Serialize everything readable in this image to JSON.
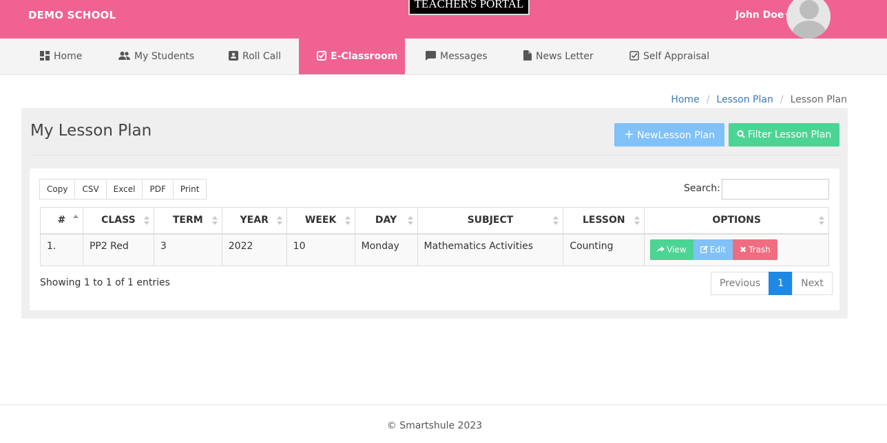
{
  "header": {
    "school_name": "DEMO SCHOOL",
    "portal_title": "TEACHER'S PORTAL",
    "user_name": "John Doe"
  },
  "nav": {
    "items": [
      {
        "label": "Home",
        "icon": "dashboard-icon"
      },
      {
        "label": "My Students",
        "icon": "people-icon"
      },
      {
        "label": "Roll Call",
        "icon": "contact-card-icon"
      },
      {
        "label": "E-Classroom",
        "icon": "checkbox-icon"
      },
      {
        "label": "Messages",
        "icon": "chat-icon"
      },
      {
        "label": "News Letter",
        "icon": "document-icon"
      },
      {
        "label": "Self Appraisal",
        "icon": "checkbox-icon"
      }
    ],
    "active": "E-Classroom"
  },
  "breadcrumb": [
    "Home",
    "Lesson Plan",
    "Lesson Plan"
  ],
  "panel": {
    "title": "My Lesson Plan",
    "new_button": "NewLesson Plan",
    "filter_button": "Filter Lesson Plan"
  },
  "export_buttons": [
    "Copy",
    "CSV",
    "Excel",
    "PDF",
    "Print"
  ],
  "search": {
    "label": "Search:",
    "value": ""
  },
  "table": {
    "columns": [
      "#",
      "CLASS",
      "TERM",
      "YEAR",
      "WEEK",
      "DAY",
      "SUBJECT",
      "LESSON",
      "OPTIONS"
    ],
    "rows": [
      {
        "num": "1.",
        "class": "PP2 Red",
        "term": "3",
        "year": "2022",
        "week": "10",
        "day": "Monday",
        "subject": "Mathematics Activities",
        "lesson": "Counting"
      }
    ],
    "actions": {
      "view": "View",
      "edit": "Edit",
      "trash": "Trash"
    }
  },
  "info": "Showing 1 to 1 of 1 entries",
  "pagination": {
    "previous": "Previous",
    "current": "1",
    "next": "Next"
  },
  "footer": "© Smartshule 2023",
  "colors": {
    "brand": "#f06292",
    "view": "#4cd495",
    "edit": "#80c1f8",
    "trash": "#f06c80",
    "page_active": "#1e88e5"
  }
}
